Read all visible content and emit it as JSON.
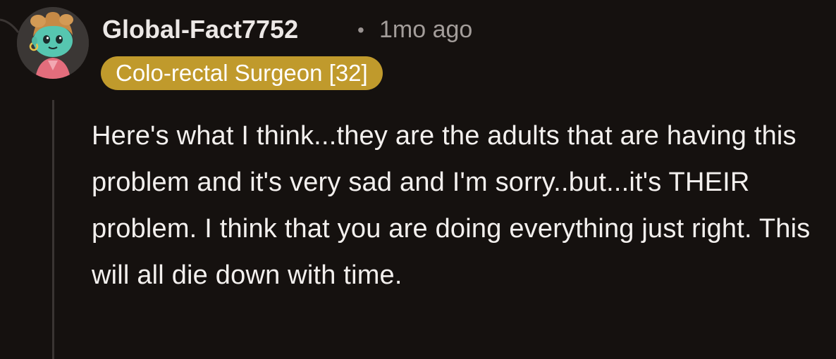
{
  "comment": {
    "author": "Global-Fact7752",
    "separator": "•",
    "timestamp": "1mo ago",
    "flair": "Colo-rectal Surgeon [32]",
    "body": "Here's what I think...they are the adults that are having this problem and it's very sad and I'm sorry..but...it's THEIR problem. I think that you are doing everything just right. This will all die down with time."
  },
  "colors": {
    "background": "#15110f",
    "flair_background": "#c09a2c",
    "text_primary": "#f3f0ee",
    "text_secondary": "#a39d9a"
  },
  "icons": {
    "avatar": "snoo-avatar-icon"
  }
}
